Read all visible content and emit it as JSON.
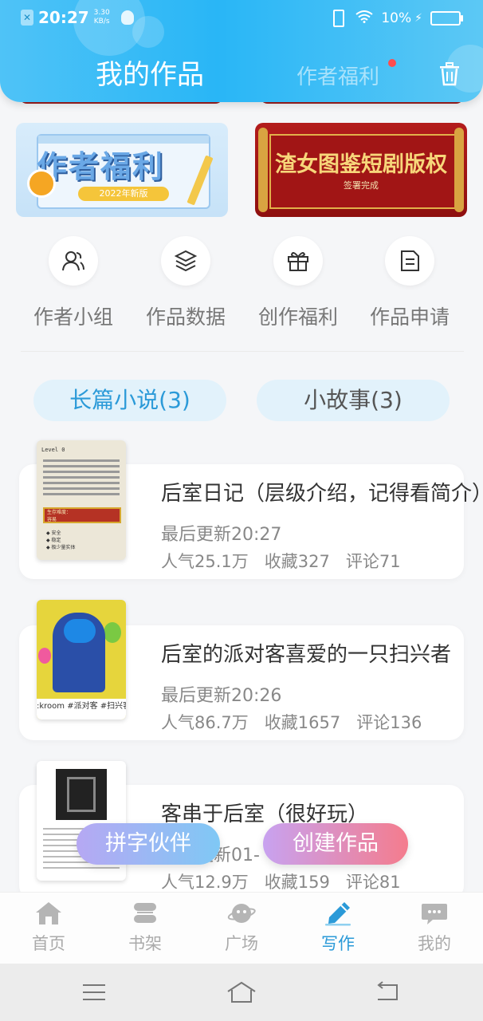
{
  "status_bar": {
    "time": "20:27",
    "speed": "3.30\nKB/s",
    "battery": "10%"
  },
  "header": {
    "title": "我的作品",
    "tab_benefits": "作者福利"
  },
  "banners": {
    "left_title": "作者福利",
    "left_badge": "2022年新版",
    "right_title": "渣女图鉴短剧版权",
    "right_sub": "签署完成"
  },
  "quick_links": [
    {
      "label": "作者小组",
      "icon": "author-group-icon"
    },
    {
      "label": "作品数据",
      "icon": "layers-icon"
    },
    {
      "label": "创作福利",
      "icon": "gift-icon"
    },
    {
      "label": "作品申请",
      "icon": "document-icon"
    }
  ],
  "categories": {
    "long": "长篇小说(3)",
    "short": "小故事(3)"
  },
  "works": [
    {
      "title": "后室日记（层级介绍，记得看简介）",
      "updated": "最后更新20:27",
      "popularity": "人气25.1万",
      "favorites": "收藏327",
      "comments": "评论71",
      "cover_header": "Level 0",
      "cover_bar": "生存难度：\n容易",
      "cover_bullets": "◆ 安全\n◆ 稳定\n◆ 极少量实体"
    },
    {
      "title": "后室的派对客喜爱的一只扫兴者",
      "updated": "最后更新20:26",
      "popularity": "人气86.7万",
      "favorites": "收藏1657",
      "comments": "评论136",
      "cover_strip": ":kroom #派对客 #扫兴客 頁"
    },
    {
      "title": "客串于后室（很好玩）",
      "updated": "最后更新01-",
      "popularity": "人气12.9万",
      "favorites": "收藏159",
      "comments": "评论81"
    }
  ],
  "fabs": {
    "partner": "拼字伙伴",
    "create": "创建作品"
  },
  "bottom_nav": [
    {
      "label": "首页",
      "icon": "home-icon"
    },
    {
      "label": "书架",
      "icon": "bookshelf-icon"
    },
    {
      "label": "广场",
      "icon": "planet-icon"
    },
    {
      "label": "写作",
      "icon": "pen-icon"
    },
    {
      "label": "我的",
      "icon": "chat-icon"
    }
  ],
  "colors": {
    "accent": "#2b9ad8",
    "header": "#29b6f6",
    "badge": "#ff4d4f"
  }
}
